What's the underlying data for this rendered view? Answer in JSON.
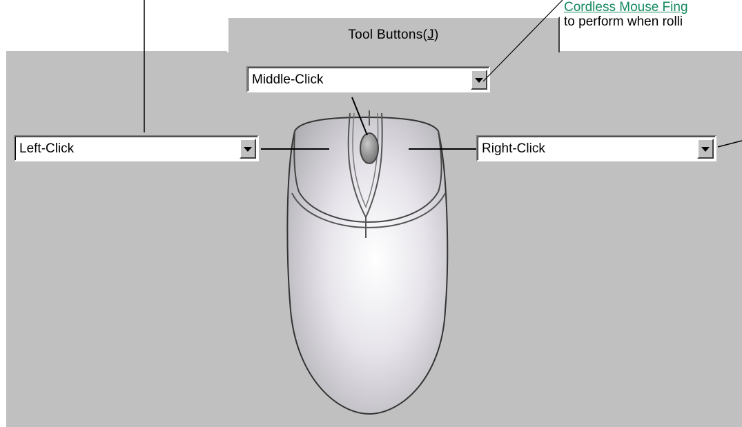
{
  "tab": {
    "label": "Tool Buttons(",
    "hotkey": "J",
    "label_end": ")"
  },
  "callout": {
    "link_text": "Cordless Mouse Fing",
    "description": "to perform when rolli"
  },
  "dropdowns": {
    "middle": {
      "value": "Middle-Click"
    },
    "left": {
      "value": "Left-Click"
    },
    "right": {
      "value": "Right-Click"
    }
  },
  "colors": {
    "panel": "#c0c0c0",
    "link": "#138a5e"
  },
  "icons": {
    "dropdown_arrow": "chevron-down-icon"
  }
}
